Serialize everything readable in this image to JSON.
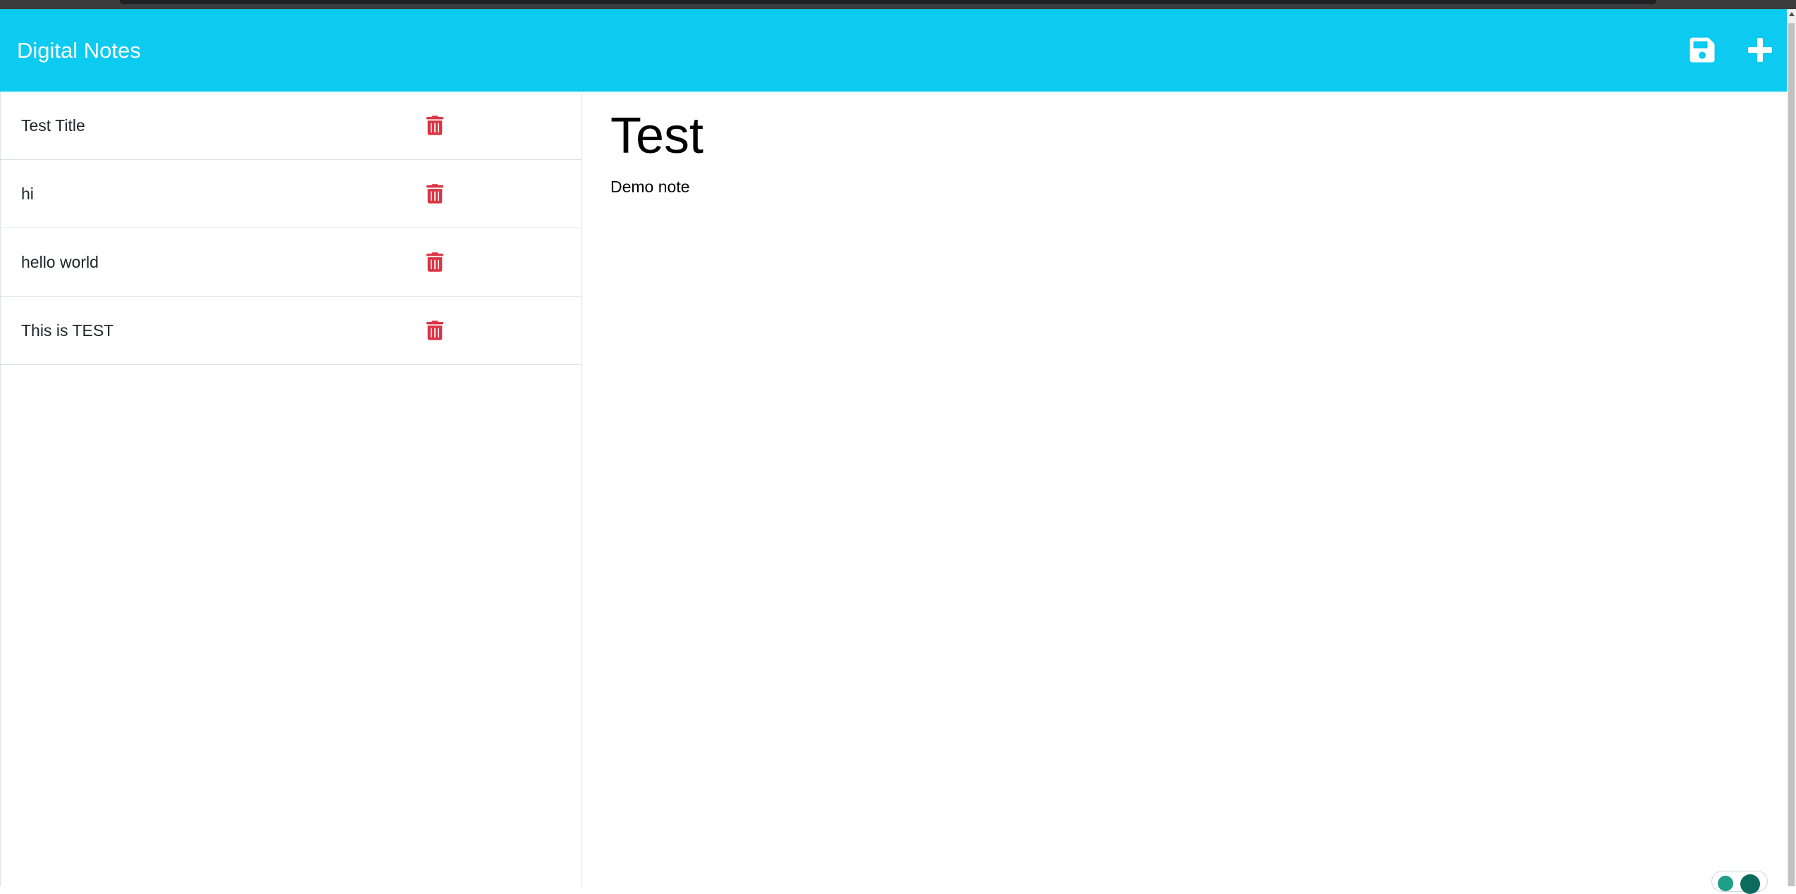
{
  "app": {
    "brand": "Digital Notes"
  },
  "toolbar": {
    "save_icon": "floppy-disk-icon",
    "add_icon": "plus-icon"
  },
  "notes": [
    {
      "title": "Test Title",
      "delete_icon": "trash-icon"
    },
    {
      "title": "hi",
      "delete_icon": "trash-icon"
    },
    {
      "title": "hello world",
      "delete_icon": "trash-icon"
    },
    {
      "title": "This is TEST",
      "delete_icon": "trash-icon"
    }
  ],
  "active_note": {
    "title": "Test",
    "body": "Demo note"
  },
  "colors": {
    "navbar": "#0dcaf0",
    "delete": "#dc3545",
    "text": "#212529"
  }
}
